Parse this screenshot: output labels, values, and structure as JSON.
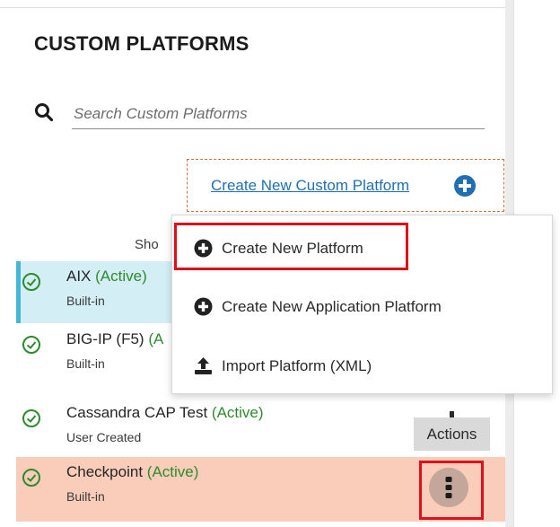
{
  "panel": {
    "title": "CUSTOM PLATFORMS",
    "search": {
      "placeholder": "Search Custom Platforms",
      "value": ""
    },
    "create_link": "Create New Custom Platform",
    "sort_label_partial": "Sho"
  },
  "dropdown": {
    "items": [
      {
        "label": "Create New Platform",
        "icon": "plus-circle-icon"
      },
      {
        "label": "Create New Application Platform",
        "icon": "plus-circle-icon"
      },
      {
        "label": "Import Platform (XML)",
        "icon": "upload-icon"
      }
    ]
  },
  "platforms": [
    {
      "name": "AIX",
      "status": "(Active)",
      "type": "Built-in"
    },
    {
      "name": "BIG-IP (F5)",
      "status": "(A",
      "type": "Built-in"
    },
    {
      "name": "Cassandra CAP Test",
      "status": "(Active)",
      "type": "User Created"
    },
    {
      "name": "Checkpoint",
      "status": "(Active)",
      "type": "Built-in"
    }
  ],
  "tooltip": {
    "actions": "Actions"
  },
  "colors": {
    "accent_link": "#1f6fb2",
    "active_status": "#2e8a2e",
    "selected_row": "#d4eef6",
    "hover_row": "#f9cdb9",
    "highlight_box": "#e0101a"
  }
}
